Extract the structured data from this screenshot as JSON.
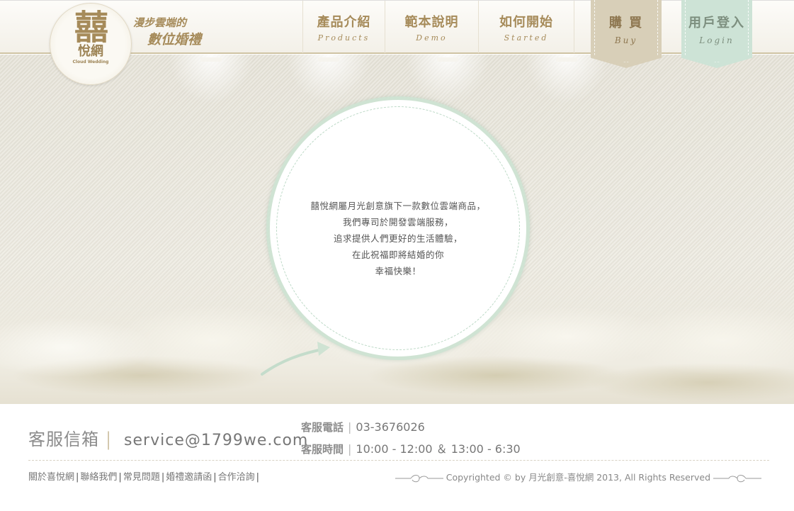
{
  "header": {
    "logo": {
      "mark": "囍",
      "name": "悅網",
      "en": "Cloud Wedding"
    },
    "slogan_line1": "漫步雲端的",
    "slogan_line2": "數位婚禮",
    "nav": [
      {
        "zh": "產品介紹",
        "en": "Products"
      },
      {
        "zh": "範本說明",
        "en": "Demo"
      },
      {
        "zh": "如何開始",
        "en": "Started"
      }
    ],
    "buy": {
      "zh": "購 買",
      "en": "Buy"
    },
    "login": {
      "zh": "用戶登入",
      "en": "Login"
    }
  },
  "hero": {
    "lines": [
      "囍悅網屬月光創意旗下一款數位雲端商品，",
      "我們專司於開發雲端服務，",
      "追求提供人們更好的生活體驗，",
      "在此祝福即將結婚的你",
      "幸福快樂！"
    ]
  },
  "footer": {
    "mail_label": "客服信箱",
    "mail_value": "service@1799we.com",
    "phone_label": "客服電話",
    "phone_value": "03-3676026",
    "hours_label": "客服時間",
    "hours_value": "10:00 - 12:00 ＆ 13:00 - 6:30",
    "links": [
      "關於喜悅網",
      "聯絡我們",
      "常見問題",
      "婚禮邀請函",
      "合作洽詢"
    ],
    "copyright": "Copyrighted © by 月光創意-喜悅網 2013, All Rights Reserved"
  }
}
